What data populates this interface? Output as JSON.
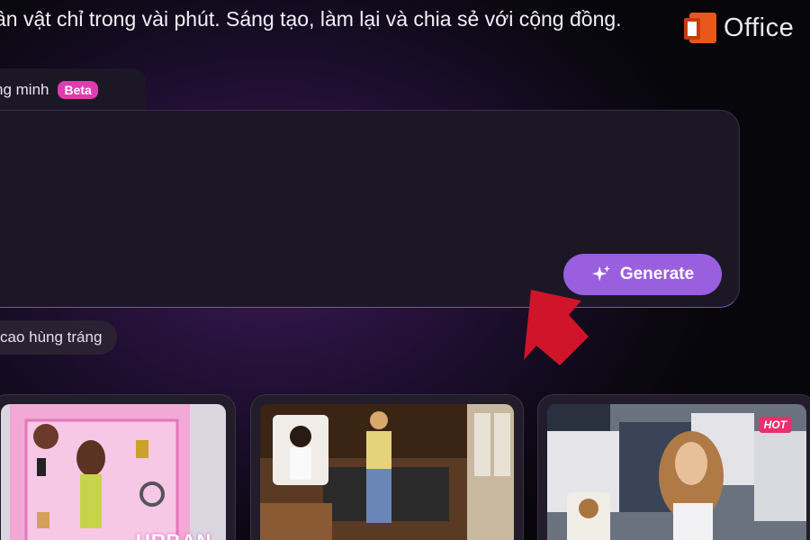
{
  "header": {
    "subtitle": "ân vật chỉ trong vài phút. Sáng tạo, làm lại và chia sẻ với cộng đồng."
  },
  "watermark": {
    "text": "Office"
  },
  "tab": {
    "label": "ng minh",
    "badge": "Beta"
  },
  "prompt": {
    "value": ""
  },
  "generate_button": {
    "label": "Generate",
    "icon": "sparkle-icon"
  },
  "suggestion_chip": {
    "label": "cao hùng tráng"
  },
  "gallery": {
    "cards": [
      {
        "name": "doll-box-card",
        "box_label": "URBAN",
        "badge": ""
      },
      {
        "name": "cafe-photo-card",
        "badge": ""
      },
      {
        "name": "stadium-fan-card",
        "badge": "HOT"
      }
    ]
  },
  "colors": {
    "accent": "#9a5fde",
    "beta_badge": "#e03bb0",
    "hot_badge": "#e8306e",
    "arrow": "#d0142a"
  }
}
